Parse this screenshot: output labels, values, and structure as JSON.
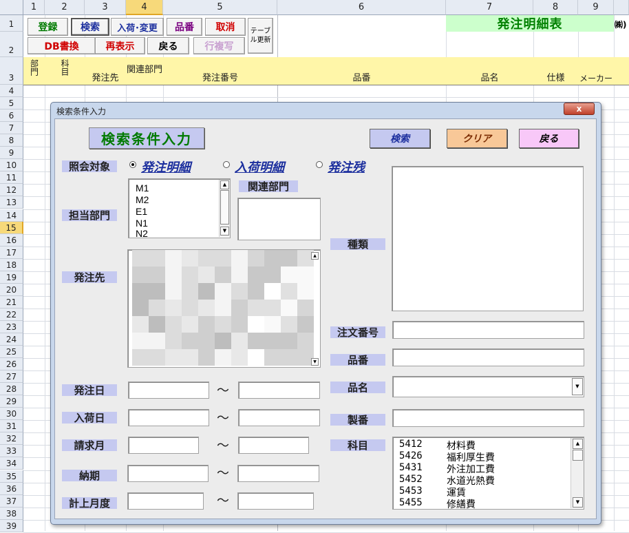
{
  "spreadsheet": {
    "columns": [
      {
        "label": "1",
        "x": 0,
        "w": 0
      },
      {
        "label": "2"
      },
      {
        "label": "3"
      },
      {
        "label": "4"
      },
      {
        "label": "5"
      },
      {
        "label": "6"
      },
      {
        "label": "7"
      },
      {
        "label": "8"
      },
      {
        "label": "9"
      }
    ],
    "rows": [
      "1",
      "2",
      "3",
      "4",
      "5",
      "6",
      "7",
      "8",
      "9",
      "10",
      "11",
      "12",
      "13",
      "14",
      "15",
      "16",
      "17",
      "18",
      "19",
      "20",
      "21",
      "22",
      "23",
      "24",
      "25",
      "26",
      "27",
      "28",
      "29",
      "30",
      "31",
      "32",
      "33",
      "34",
      "35",
      "36",
      "37",
      "38",
      "39"
    ],
    "title": "発注明細表",
    "company_suffix": "㈱)",
    "buttons": {
      "register": "登録",
      "search": "検索",
      "arrival_change": "入荷･変更",
      "item_no": "品番",
      "cancel": "取消",
      "table_update": "テーブル更新",
      "db_write": "DB書換",
      "redisplay": "再表示",
      "back": "戻る",
      "row_copy": "行複写"
    },
    "header_cells": [
      "部門",
      "科目",
      "発注先",
      "関連部門",
      "発注番号",
      "品番",
      "品名",
      "仕様",
      "メーカー"
    ],
    "colors": {
      "header_fill": "#fff6a8",
      "title_fill": "#ccffcc",
      "title_text": "#008000"
    }
  },
  "dialog": {
    "window_title": "検索条件入力",
    "close_label": "x",
    "heading": "検索条件入力",
    "buttons": {
      "search": "検索",
      "clear": "クリア",
      "back": "戻る"
    },
    "inquiry_label": "照会対象",
    "radio_options": [
      {
        "label": "発注明細",
        "selected": true
      },
      {
        "label": "入荷明細",
        "selected": false
      },
      {
        "label": "発注残",
        "selected": false
      }
    ],
    "dept_label": "担当部門",
    "dept_items": [
      "M1",
      "M2",
      "E1",
      "N1",
      "N2"
    ],
    "related_dept_label": "関連部門",
    "supplier_label": "発注先",
    "order_date_label": "発注日",
    "arrival_date_label": "入荷日",
    "billing_month_label": "請求月",
    "due_label": "納期",
    "posting_month_label": "計上月度",
    "range_sep": "～",
    "type_label": "種類",
    "order_no_label": "注文番号",
    "item_no_label": "品番",
    "item_name_label": "品名",
    "prod_no_label": "製番",
    "account_label": "科目",
    "account_items": [
      {
        "code": "5412",
        "name": "材料費"
      },
      {
        "code": "5426",
        "name": "福利厚生費"
      },
      {
        "code": "5431",
        "name": "外注加工費"
      },
      {
        "code": "5452",
        "name": "水道光熱費"
      },
      {
        "code": "5453",
        "name": "運賃"
      },
      {
        "code": "5455",
        "name": "修繕費"
      }
    ]
  }
}
